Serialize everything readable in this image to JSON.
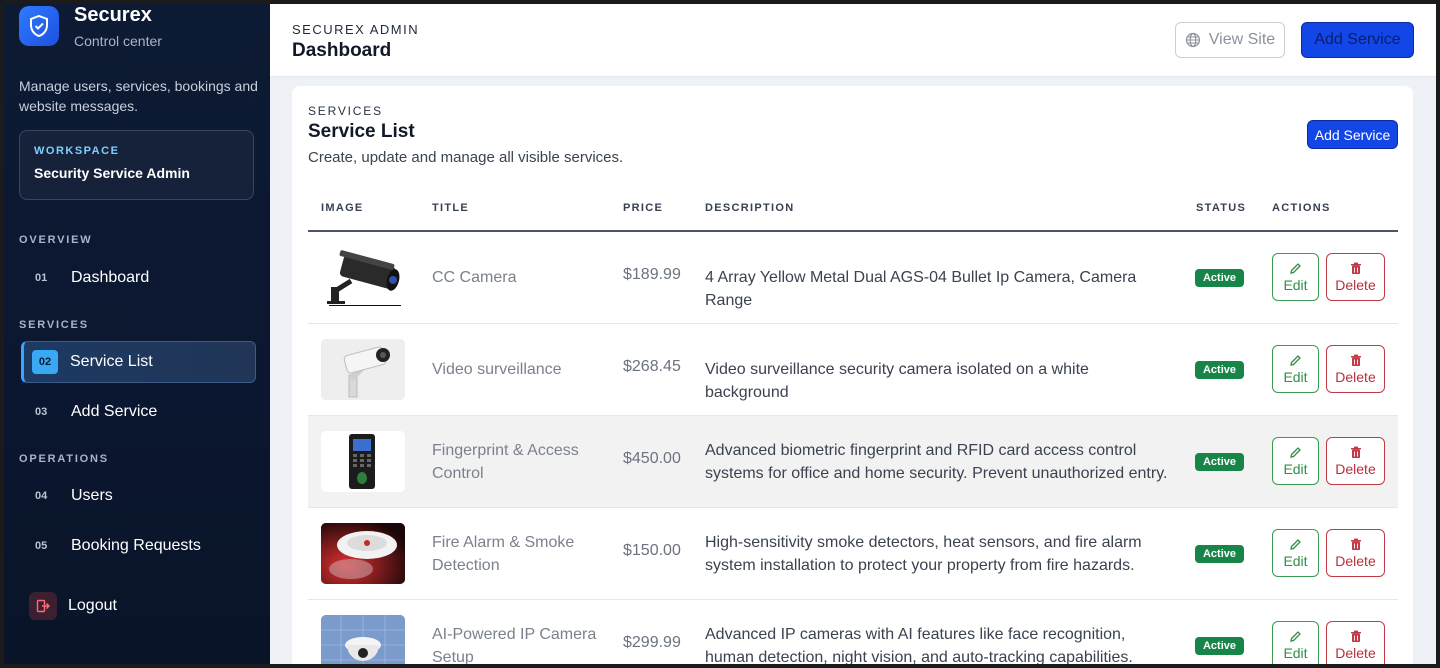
{
  "brand": {
    "name": "Securex",
    "subtitle": "Control center"
  },
  "sidebar": {
    "description": "Manage users, services, bookings and website messages.",
    "workspace": {
      "label": "WORKSPACE",
      "value": "Security Service Admin"
    },
    "sections": {
      "overview": "OVERVIEW",
      "services": "SERVICES",
      "operations": "OPERATIONS"
    },
    "items": [
      {
        "num": "01",
        "label": "Dashboard"
      },
      {
        "num": "02",
        "label": "Service List",
        "active": true
      },
      {
        "num": "03",
        "label": "Add Service"
      },
      {
        "num": "04",
        "label": "Users"
      },
      {
        "num": "05",
        "label": "Booking Requests"
      }
    ],
    "logout": "Logout"
  },
  "topbar": {
    "subtitle": "SECUREX ADMIN",
    "title": "Dashboard",
    "view_site": "View Site",
    "add_service": "Add Service"
  },
  "card": {
    "subtitle": "SERVICES",
    "title": "Service List",
    "description": "Create, update and manage all visible services.",
    "add_service": "Add Service"
  },
  "table": {
    "headers": [
      "IMAGE",
      "TITLE",
      "PRICE",
      "DESCRIPTION",
      "STATUS",
      "ACTIONS"
    ],
    "rows": [
      {
        "image": "bullet-camera",
        "title": "CC Camera",
        "price": "$189.99",
        "description": "4 Array Yellow Metal Dual AGS-04 Bullet Ip Camera, Camera Range",
        "status": "Active"
      },
      {
        "image": "surveillance-camera",
        "title": "Video surveillance",
        "price": "$268.45",
        "description": "Video surveillance security camera isolated on a white background",
        "status": "Active"
      },
      {
        "image": "fingerprint-device",
        "title": "Fingerprint & Access Control",
        "price": "$450.00",
        "description": "Advanced biometric fingerprint and RFID card access control systems for office and home security. Prevent unauthorized entry.",
        "status": "Active"
      },
      {
        "image": "smoke-detector",
        "title": "Fire Alarm & Smoke Detection",
        "price": "$150.00",
        "description": "High-sensitivity smoke detectors, heat sensors, and fire alarm system installation to protect your property from fire hazards.",
        "status": "Active"
      },
      {
        "image": "dome-camera",
        "title": "AI-Powered IP Camera Setup",
        "price": "$299.99",
        "description": "Advanced IP cameras with AI features like face recognition, human detection, night vision, and auto-tracking capabilities.",
        "status": "Active"
      }
    ],
    "edit_label": "Edit",
    "delete_label": "Delete"
  },
  "colors": {
    "sidebar_bg": "#0d1a33",
    "accent": "#1346e6",
    "active_badge": "#188548",
    "edit": "#2f8f47",
    "delete": "#b8303c"
  }
}
